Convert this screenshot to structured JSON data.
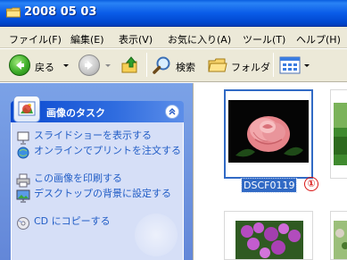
{
  "window": {
    "title": "2008 05 03"
  },
  "menu": [
    {
      "label": "ファイル(F)"
    },
    {
      "label": "編集(E)"
    },
    {
      "label": "表示(V)"
    },
    {
      "label": "お気に入り(A)"
    },
    {
      "label": "ツール(T)"
    },
    {
      "label": "ヘルプ(H)"
    }
  ],
  "toolbar": {
    "back_label": "戻る",
    "search_label": "検索",
    "folders_label": "フォルダ"
  },
  "task_pane": {
    "title": "画像のタスク",
    "tasks": [
      {
        "label": "スライドショーを表示する",
        "icon": "slideshow-icon"
      },
      {
        "label": "オンラインでプリントを注文する",
        "icon": "online-print-icon"
      },
      {
        "label": "この画像を印刷する",
        "icon": "printer-icon"
      },
      {
        "label": "デスクトップの背景に設定する",
        "icon": "desktop-background-icon"
      },
      {
        "label": "CD にコピーする",
        "icon": "cd-icon"
      }
    ]
  },
  "files": {
    "selected_name": "DSCF0119",
    "callout": "①"
  },
  "colors": {
    "titlebar": "#0a5ce8",
    "task_link": "#215dc6",
    "selection": "#316ac5",
    "callout": "#d91515"
  }
}
